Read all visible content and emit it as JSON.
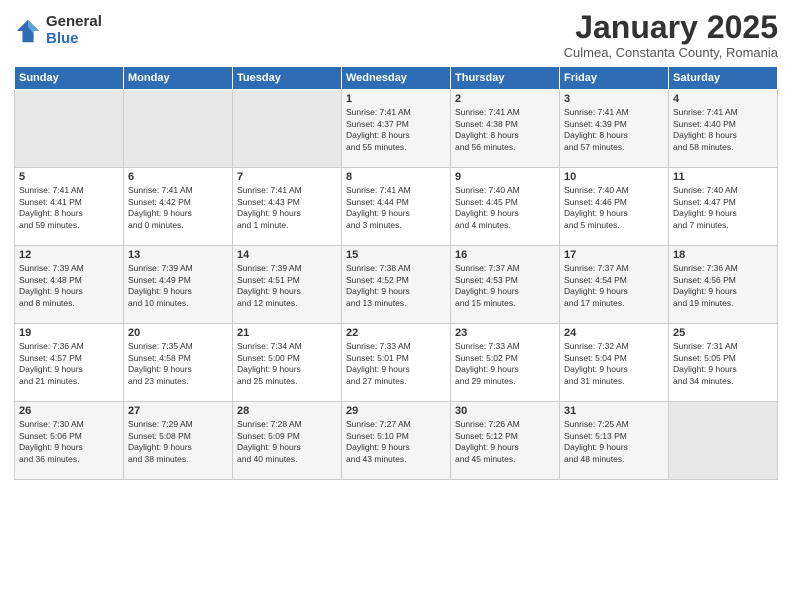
{
  "logo": {
    "general": "General",
    "blue": "Blue"
  },
  "title": "January 2025",
  "location": "Culmea, Constanta County, Romania",
  "headers": [
    "Sunday",
    "Monday",
    "Tuesday",
    "Wednesday",
    "Thursday",
    "Friday",
    "Saturday"
  ],
  "weeks": [
    [
      {
        "day": "",
        "info": ""
      },
      {
        "day": "",
        "info": ""
      },
      {
        "day": "",
        "info": ""
      },
      {
        "day": "1",
        "info": "Sunrise: 7:41 AM\nSunset: 4:37 PM\nDaylight: 8 hours\nand 55 minutes."
      },
      {
        "day": "2",
        "info": "Sunrise: 7:41 AM\nSunset: 4:38 PM\nDaylight: 8 hours\nand 56 minutes."
      },
      {
        "day": "3",
        "info": "Sunrise: 7:41 AM\nSunset: 4:39 PM\nDaylight: 8 hours\nand 57 minutes."
      },
      {
        "day": "4",
        "info": "Sunrise: 7:41 AM\nSunset: 4:40 PM\nDaylight: 8 hours\nand 58 minutes."
      }
    ],
    [
      {
        "day": "5",
        "info": "Sunrise: 7:41 AM\nSunset: 4:41 PM\nDaylight: 8 hours\nand 59 minutes."
      },
      {
        "day": "6",
        "info": "Sunrise: 7:41 AM\nSunset: 4:42 PM\nDaylight: 9 hours\nand 0 minutes."
      },
      {
        "day": "7",
        "info": "Sunrise: 7:41 AM\nSunset: 4:43 PM\nDaylight: 9 hours\nand 1 minute."
      },
      {
        "day": "8",
        "info": "Sunrise: 7:41 AM\nSunset: 4:44 PM\nDaylight: 9 hours\nand 3 minutes."
      },
      {
        "day": "9",
        "info": "Sunrise: 7:40 AM\nSunset: 4:45 PM\nDaylight: 9 hours\nand 4 minutes."
      },
      {
        "day": "10",
        "info": "Sunrise: 7:40 AM\nSunset: 4:46 PM\nDaylight: 9 hours\nand 5 minutes."
      },
      {
        "day": "11",
        "info": "Sunrise: 7:40 AM\nSunset: 4:47 PM\nDaylight: 9 hours\nand 7 minutes."
      }
    ],
    [
      {
        "day": "12",
        "info": "Sunrise: 7:39 AM\nSunset: 4:48 PM\nDaylight: 9 hours\nand 8 minutes."
      },
      {
        "day": "13",
        "info": "Sunrise: 7:39 AM\nSunset: 4:49 PM\nDaylight: 9 hours\nand 10 minutes."
      },
      {
        "day": "14",
        "info": "Sunrise: 7:39 AM\nSunset: 4:51 PM\nDaylight: 9 hours\nand 12 minutes."
      },
      {
        "day": "15",
        "info": "Sunrise: 7:38 AM\nSunset: 4:52 PM\nDaylight: 9 hours\nand 13 minutes."
      },
      {
        "day": "16",
        "info": "Sunrise: 7:37 AM\nSunset: 4:53 PM\nDaylight: 9 hours\nand 15 minutes."
      },
      {
        "day": "17",
        "info": "Sunrise: 7:37 AM\nSunset: 4:54 PM\nDaylight: 9 hours\nand 17 minutes."
      },
      {
        "day": "18",
        "info": "Sunrise: 7:36 AM\nSunset: 4:56 PM\nDaylight: 9 hours\nand 19 minutes."
      }
    ],
    [
      {
        "day": "19",
        "info": "Sunrise: 7:36 AM\nSunset: 4:57 PM\nDaylight: 9 hours\nand 21 minutes."
      },
      {
        "day": "20",
        "info": "Sunrise: 7:35 AM\nSunset: 4:58 PM\nDaylight: 9 hours\nand 23 minutes."
      },
      {
        "day": "21",
        "info": "Sunrise: 7:34 AM\nSunset: 5:00 PM\nDaylight: 9 hours\nand 25 minutes."
      },
      {
        "day": "22",
        "info": "Sunrise: 7:33 AM\nSunset: 5:01 PM\nDaylight: 9 hours\nand 27 minutes."
      },
      {
        "day": "23",
        "info": "Sunrise: 7:33 AM\nSunset: 5:02 PM\nDaylight: 9 hours\nand 29 minutes."
      },
      {
        "day": "24",
        "info": "Sunrise: 7:32 AM\nSunset: 5:04 PM\nDaylight: 9 hours\nand 31 minutes."
      },
      {
        "day": "25",
        "info": "Sunrise: 7:31 AM\nSunset: 5:05 PM\nDaylight: 9 hours\nand 34 minutes."
      }
    ],
    [
      {
        "day": "26",
        "info": "Sunrise: 7:30 AM\nSunset: 5:06 PM\nDaylight: 9 hours\nand 36 minutes."
      },
      {
        "day": "27",
        "info": "Sunrise: 7:29 AM\nSunset: 5:08 PM\nDaylight: 9 hours\nand 38 minutes."
      },
      {
        "day": "28",
        "info": "Sunrise: 7:28 AM\nSunset: 5:09 PM\nDaylight: 9 hours\nand 40 minutes."
      },
      {
        "day": "29",
        "info": "Sunrise: 7:27 AM\nSunset: 5:10 PM\nDaylight: 9 hours\nand 43 minutes."
      },
      {
        "day": "30",
        "info": "Sunrise: 7:26 AM\nSunset: 5:12 PM\nDaylight: 9 hours\nand 45 minutes."
      },
      {
        "day": "31",
        "info": "Sunrise: 7:25 AM\nSunset: 5:13 PM\nDaylight: 9 hours\nand 48 minutes."
      },
      {
        "day": "",
        "info": ""
      }
    ]
  ]
}
